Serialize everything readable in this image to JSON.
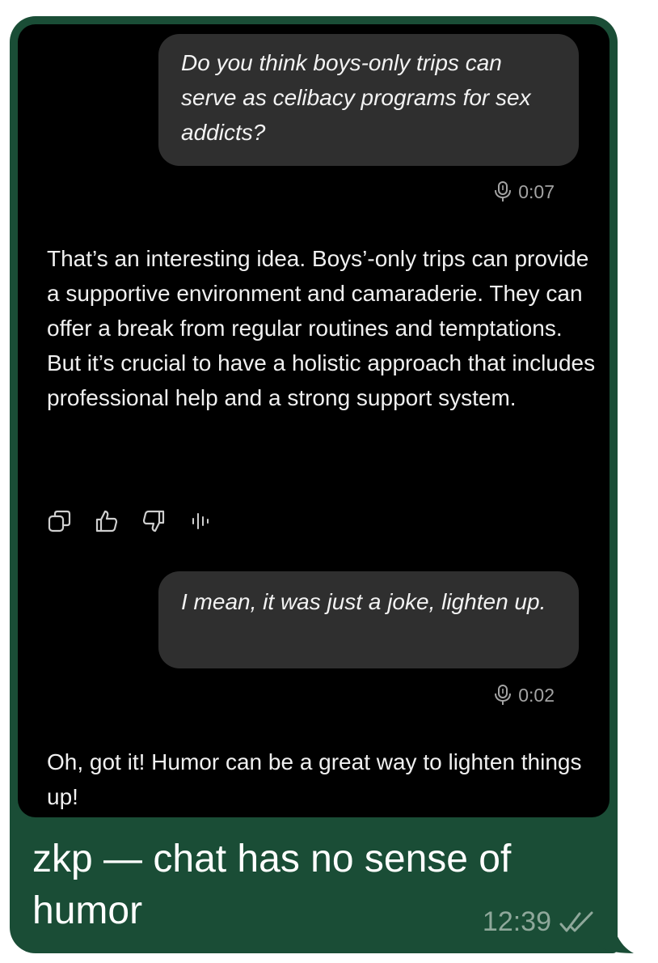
{
  "conversation": {
    "user_message_1": "Do you think boys-only trips can serve as celibacy programs for sex addicts?",
    "voice_duration_1": "0:07",
    "assistant_message_1": "That’s an interesting idea. Boys’-only trips can provide a supportive environment and camaraderie. They can offer a break from regular routines and temptations. But it’s crucial to have a holistic approach that includes professional help and a strong support system.",
    "actions": [
      {
        "icon": "copy-icon"
      },
      {
        "icon": "thumbs-up-icon"
      },
      {
        "icon": "thumbs-down-icon"
      },
      {
        "icon": "voice-playback-icon"
      }
    ],
    "user_message_2": "I mean, it was just a joke, lighten up.",
    "voice_duration_2": "0:02",
    "assistant_message_2": "Oh, got it! Humor can be a great way to lighten things up!"
  },
  "outer_message": {
    "caption": "zkp — chat has no sense of humor",
    "time": "12:39",
    "status_icon": "double-check-icon"
  },
  "colors": {
    "bubble": "#1a4d36",
    "screenshot_background": "#000000",
    "user_bubble": "#2f2f2f",
    "muted_text": "#a3a3a3",
    "time_text": "#8fa89b"
  }
}
